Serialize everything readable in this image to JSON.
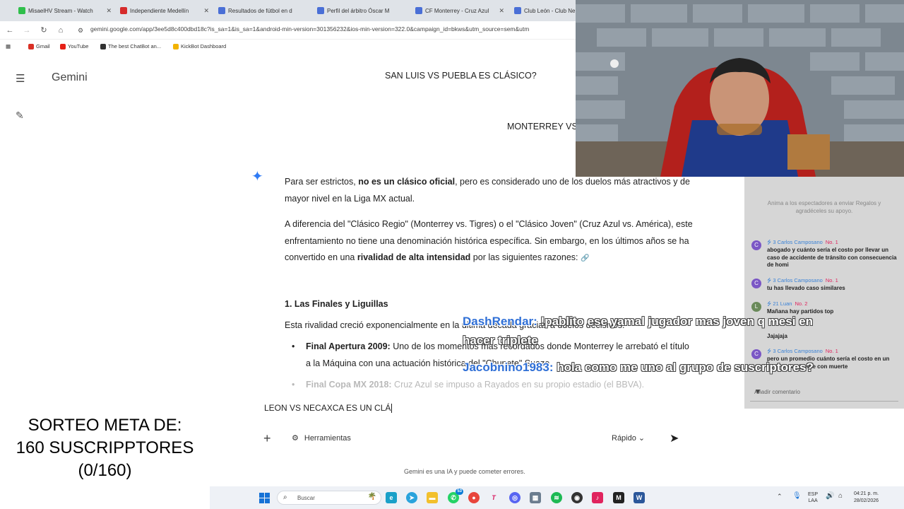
{
  "browser": {
    "tabs": [
      {
        "label": "MisaelHV Stream - Watch",
        "color": "#2fbf4b"
      },
      {
        "label": "Independiente Medellín",
        "color": "#d62b2b"
      },
      {
        "label": "Resultados de fútbol en d",
        "color": "#4a6fd6"
      },
      {
        "label": "Perfil del árbitro Óscar M",
        "color": "#4a6fd6"
      },
      {
        "label": "CF Monterrey - Cruz Azul",
        "color": "#4a6fd6"
      },
      {
        "label": "Club León - Club Ne",
        "color": "#4a6fd6"
      }
    ],
    "url": "gemini.google.com/app/3ee5d8c400dbd18c?is_sa=1&is_sa=1&android-min-version=301356232&ios-min-version=322.0&campaign_id=bkws&utm_source=sem&utm",
    "bookmarks": [
      {
        "label": "Gmail",
        "color": "#d93025"
      },
      {
        "label": "YouTube",
        "color": "#e62117"
      },
      {
        "label": "The best ChatBot an...",
        "color": "#333333"
      },
      {
        "label": "KickBot Dashboard",
        "color": "#f2b300"
      }
    ]
  },
  "gemini": {
    "brand": "Gemini",
    "user_msg_1": "SAN LUIS VS PUEBLA ES CLÁSICO?",
    "user_msg_2": "MONTERREY VS",
    "p1_a": "Para ser estrictos, ",
    "p1_b": "no es un clásico oficial",
    "p1_c": ", pero es considerado uno de los duelos más atractivos y de mayor nivel en la Liga MX actual.",
    "p2_a": "A diferencia del \"Clásico Regio\" (Monterrey vs. Tigres) o el \"Clásico Joven\" (Cruz Azul vs. América), este enfrentamiento no tiene una denominación histórica específica. Sin embargo, en los últimos años se ha convertido en una ",
    "p2_b": "rivalidad de alta intensidad",
    "p2_c": " por las siguientes razones:",
    "h3": "1. Las Finales y Liguillas",
    "p3": "Esta rivalidad creció exponencialmente en la última década gracias a duelos decisivos:",
    "b1_title": "Final Apertura 2009:",
    "b1_text": " Uno de los momentos más recordados donde Monterrey le arrebató el título a la Máquina con una actuación histórica del \"Chupete\" Suazo.",
    "b2_title": "Final Copa MX 2018:",
    "b2_text": " Cruz Azul se impuso a Rayados en su propio estadio (el BBVA).",
    "input_value": "LEON VS NECAXCA ES UN CLÁ",
    "tools_label": "Herramientas",
    "model_label": "Rápido",
    "disclaimer": "Gemini es una IA y puede cometer errores."
  },
  "chat": {
    "hint": "Anima a los espectadores a enviar Regalos y agradéceles su apoyo.",
    "messages": [
      {
        "avatar": "C",
        "name": "Carlos Camposano",
        "level": "3",
        "rank": "No. 1",
        "text": "abogado y cuánto sería el costo por llevar un caso de accidente de tránsito con consecuencia de homi"
      },
      {
        "avatar": "C",
        "name": "Carlos Camposano",
        "level": "3",
        "rank": "No. 1",
        "text": "tu has llevado caso similares"
      },
      {
        "avatar": "L",
        "name": "Luan",
        "level": "21",
        "rank": "No. 2",
        "text": "Mañana hay partidos top"
      },
      {
        "avatar": "",
        "name": "",
        "level": "",
        "rank": "",
        "text": "Jajajaja"
      },
      {
        "avatar": "C",
        "name": "Carlos Camposano",
        "level": "3",
        "rank": "No. 1",
        "text": "pero un promedio cuánto sería el costo en un caso de accidente con muerte"
      }
    ],
    "comment_placeholder": "Añadir comentario"
  },
  "alerts": [
    {
      "name": "DashRendar:",
      "text": " !pablito ese yamal jugador mas joven q mesi en"
    },
    {
      "name": "",
      "text": "hacer triplete"
    },
    {
      "name": "Jacobnino1983:",
      "text": " hola como me uno al grupo de suscriptores?"
    }
  ],
  "sorteo": {
    "line1": "SORTEO META DE:",
    "line2": "160 SUSCRIPPTORES",
    "line3": "(0/160)"
  },
  "taskbar": {
    "search_placeholder": "Buscar",
    "whatsapp_badge": "53",
    "lang_top": "ESP",
    "lang_bottom": "LAA",
    "time": "04:21 p. m.",
    "date": "28/02/2026"
  }
}
